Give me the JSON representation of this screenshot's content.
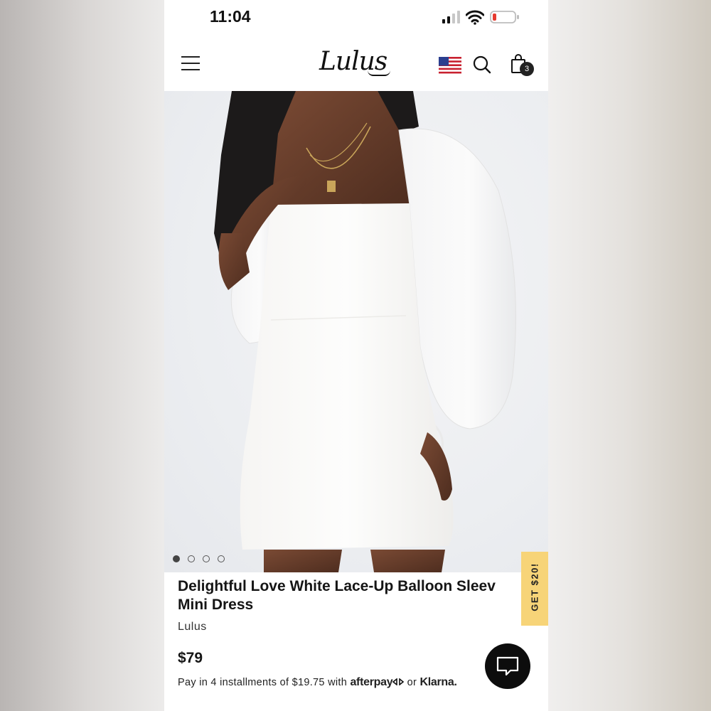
{
  "status_bar": {
    "time": "11:04"
  },
  "header": {
    "logo": "Lulus",
    "cart_count": "3"
  },
  "hero": {
    "image_alt": "Model wearing white balloon sleeve mini dress",
    "dots": [
      {
        "active": true
      },
      {
        "active": false
      },
      {
        "active": false
      },
      {
        "active": false
      }
    ]
  },
  "promo_tab": {
    "label": "GET $20!"
  },
  "product": {
    "title": "Delightful Love White Lace-Up Balloon Sleev Mini Dress",
    "brand": "Lulus",
    "price": "$79",
    "installments_prefix": "Pay in 4 installments of $19.75 with",
    "afterpay": "afterpay",
    "or": "or",
    "klarna": "Klarna."
  },
  "colors": {
    "accent_yellow": "#f7d478",
    "chat_button": "#0d0d0d",
    "text": "#151515"
  },
  "icons": [
    "menu-icon",
    "us-flag-icon",
    "search-icon",
    "shopping-bag-icon",
    "chat-icon",
    "signal-icon",
    "wifi-icon",
    "battery-icon"
  ]
}
